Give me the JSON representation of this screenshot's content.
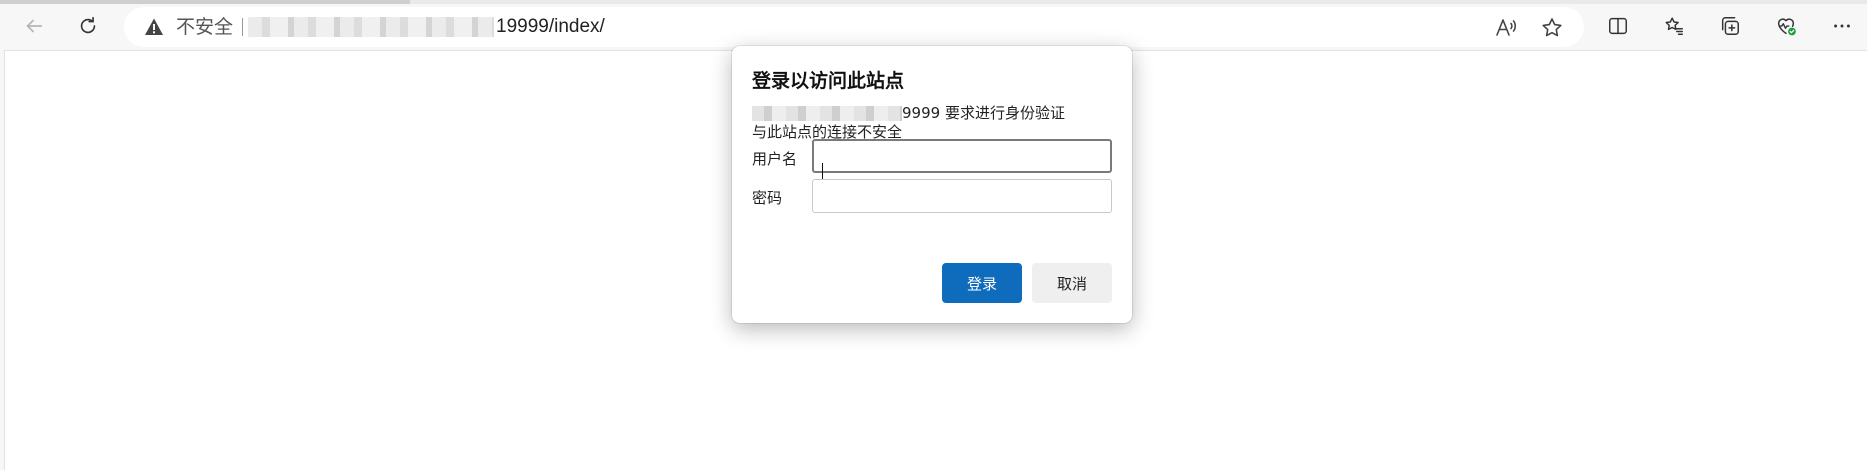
{
  "browser": {
    "security_label": "不安全",
    "url_suffix": "19999/index/",
    "icons": {
      "back": "back-arrow-icon",
      "refresh": "refresh-icon",
      "warning": "warning-icon",
      "read_aloud": "read-aloud-icon",
      "favorite": "star-icon",
      "split_screen": "split-screen-icon",
      "favorites_list": "favorites-icon",
      "collections": "collections-icon",
      "health": "browser-essentials-icon"
    }
  },
  "dialog": {
    "title": "登录以访问此站点",
    "line1_suffix": "9999 要求进行身份验证",
    "line2": "与此站点的连接不安全",
    "username_label": "用户名",
    "username_value": "",
    "password_label": "密码",
    "password_value": "",
    "login_button": "登录",
    "cancel_button": "取消"
  },
  "colors": {
    "primary": "#0f6cbd",
    "health_badge": "#1a9e3f"
  }
}
